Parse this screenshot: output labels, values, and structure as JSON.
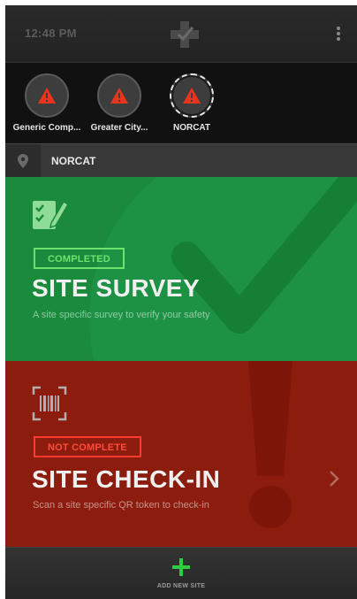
{
  "status_bar": {
    "time": "12:48 PM"
  },
  "sites": [
    {
      "label": "Generic Comp...",
      "status": "warning-icon"
    },
    {
      "label": "Greater City...",
      "status": "warning-icon"
    },
    {
      "label": "NORCAT",
      "status": "warning-icon",
      "selected": true
    }
  ],
  "location": {
    "name": "NORCAT"
  },
  "cards": {
    "survey": {
      "badge": "COMPLETED",
      "title": "SITE SURVEY",
      "description": "A site specific survey to verify your safety"
    },
    "checkin": {
      "badge": "NOT COMPLETE",
      "title": "SITE CHECK-IN",
      "description": "Scan a site specific QR token to check-in"
    }
  },
  "bottom": {
    "add_label": "ADD NEW SITE"
  },
  "colors": {
    "survey_bg": "#1a8a3d",
    "checkin_bg": "#8c1d0e",
    "completed": "#6ee36b",
    "not_complete": "#ff3b30",
    "warning": "#e8341c",
    "accent_plus": "#2ecc40"
  }
}
